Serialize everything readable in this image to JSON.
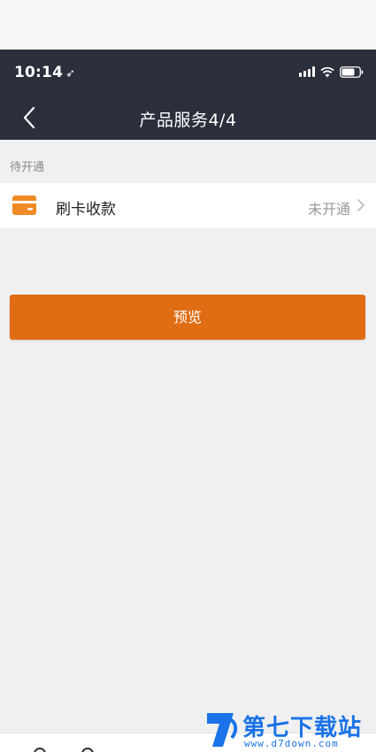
{
  "status_bar": {
    "time": "10:14",
    "location_glyph": "➶"
  },
  "nav": {
    "title": "产品服务4/4",
    "back_icon": "chevron-left-icon"
  },
  "section": {
    "label": "待开通"
  },
  "services": [
    {
      "name": "刷卡收款",
      "status": "未开通",
      "icon": "credit-card-icon",
      "icon_color": "#f08a24"
    }
  ],
  "actions": {
    "preview_label": "预览"
  },
  "watermark": {
    "text": "第七下载站",
    "url": "www.d7down.com"
  },
  "colors": {
    "nav_bg": "#2b2f3b",
    "accent": "#e06c14",
    "page_bg": "#f0f0f0"
  }
}
